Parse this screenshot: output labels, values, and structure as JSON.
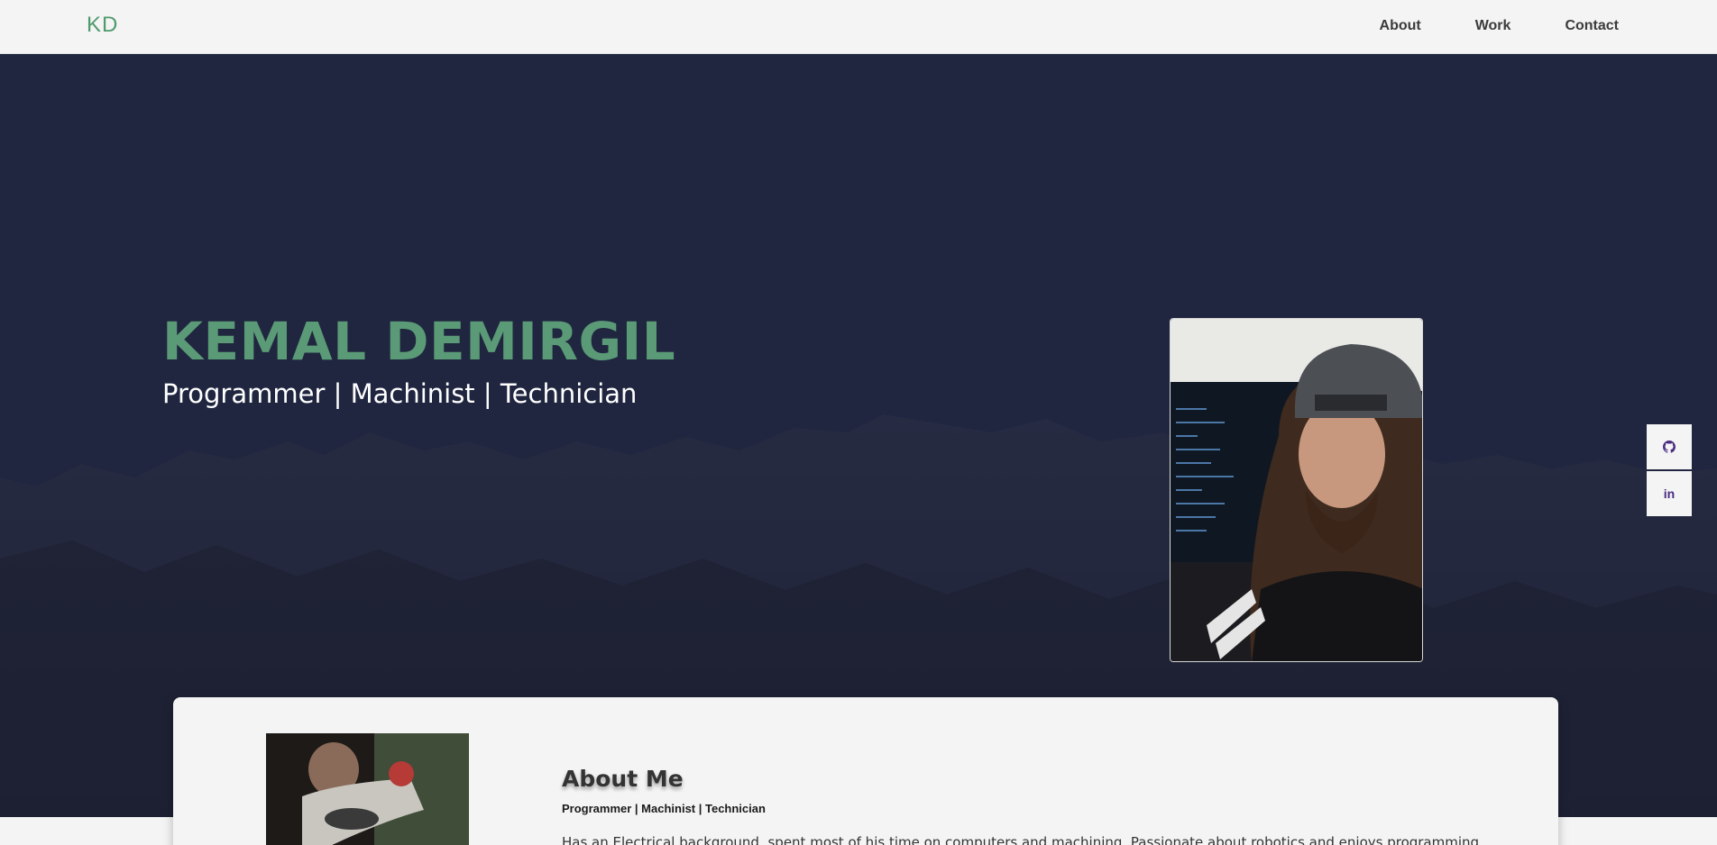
{
  "nav": {
    "brand": "KD",
    "links": [
      "About",
      "Work",
      "Contact"
    ]
  },
  "hero": {
    "name": "KEMAL DEMIRGIL",
    "tagline": "Programmer | Machinist | Technician"
  },
  "social": {
    "items": [
      {
        "icon": "github-icon"
      },
      {
        "icon": "linkedin-icon",
        "glyph": "in"
      }
    ]
  },
  "about": {
    "title": "About Me",
    "subtitle": "Programmer | Machinist | Technician",
    "description": "Has an Electrical background, spent most of his time on computers and machining. Passionate about robotics and enjoys programming."
  },
  "colors": {
    "accent": "#5b9a76",
    "hero_bg": "#202640",
    "navbar_bg": "#f4f4f4",
    "social_icon": "#4a2c82"
  }
}
